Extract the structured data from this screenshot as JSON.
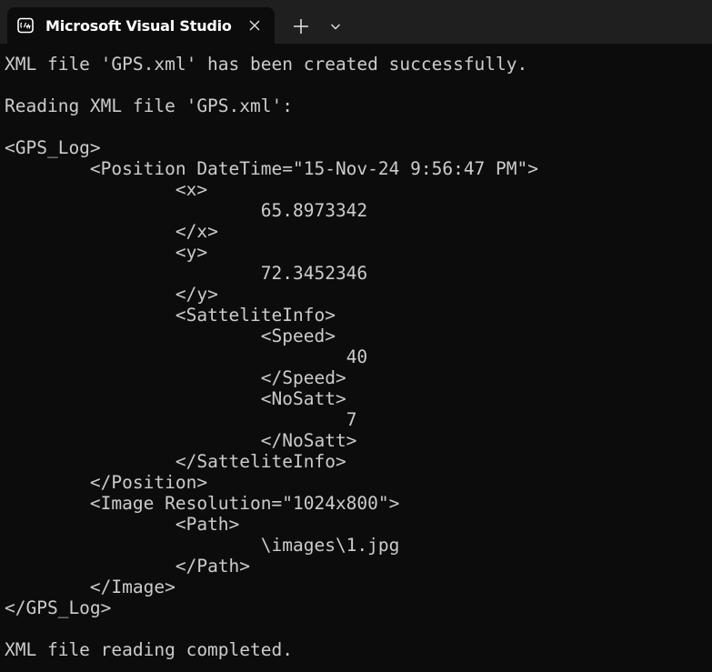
{
  "tab": {
    "icon": "console-icon",
    "title": "Microsoft Visual Studio"
  },
  "colors": {
    "titlebar": "#1f1f1f",
    "background": "#0c0c0c",
    "text": "#cccccc",
    "tab_title": "#ffffff"
  },
  "console_lines": [
    "XML file 'GPS.xml' has been created successfully.",
    "",
    "Reading XML file 'GPS.xml':",
    "",
    "<GPS_Log>",
    "\t<Position DateTime=\"15-Nov-24 9:56:47 PM\">",
    "\t\t<x>",
    "\t\t\t65.8973342",
    "\t\t</x>",
    "\t\t<y>",
    "\t\t\t72.3452346",
    "\t\t</y>",
    "\t\t<SatteliteInfo>",
    "\t\t\t<Speed>",
    "\t\t\t\t40",
    "\t\t\t</Speed>",
    "\t\t\t<NoSatt>",
    "\t\t\t\t7",
    "\t\t\t</NoSatt>",
    "\t\t</SatteliteInfo>",
    "\t</Position>",
    "\t<Image Resolution=\"1024x800\">",
    "\t\t<Path>",
    "\t\t\t\\images\\1.jpg",
    "\t\t</Path>",
    "\t</Image>",
    "</GPS_Log>",
    "",
    "XML file reading completed."
  ]
}
